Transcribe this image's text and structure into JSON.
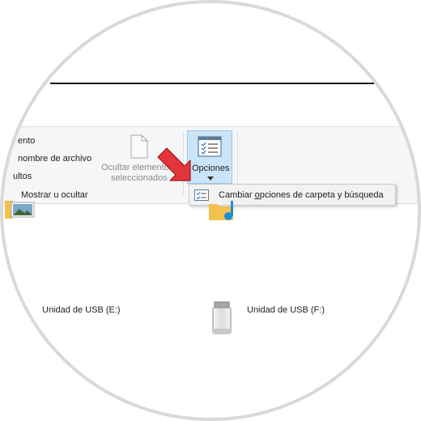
{
  "ribbon": {
    "partial_items": [
      "ento",
      "nombre de archivo",
      "ultos"
    ],
    "group_label": "Mostrar u ocultar",
    "hide_selected": {
      "line1": "Ocultar elementos",
      "line2": "seleccionados"
    },
    "options_label": "Opciones"
  },
  "context_menu": {
    "item_prefix": "Cambiar ",
    "item_underlined": "o",
    "item_rest": "pciones de carpeta y búsqueda"
  },
  "drives": [
    {
      "label": "Unidad de USB (E:)"
    },
    {
      "label": "Unidad de USB (F:)"
    }
  ]
}
